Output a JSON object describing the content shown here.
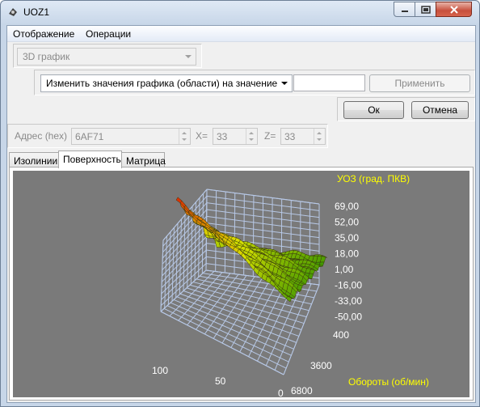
{
  "window": {
    "title": "UOZ1"
  },
  "menu": {
    "items": [
      "Отображение",
      "Операции"
    ]
  },
  "view_select": {
    "value": "3D график"
  },
  "operation": {
    "select_value": "Изменить значения графика (области) на значение",
    "value_input": "",
    "apply_label": "Применить"
  },
  "dialog": {
    "ok_label": "Ок",
    "cancel_label": "Отмена"
  },
  "address": {
    "label": "Адрес (hex)",
    "value": "6AF71",
    "x_label": "X=",
    "x_value": "33",
    "z_label": "Z=",
    "z_value": "33"
  },
  "tabs": [
    "Изолинии",
    "Поверхность",
    "Матрица"
  ],
  "active_tab": 1,
  "colors": {
    "plot_bg": "#7a7a7a",
    "axis_text": "#ffff00",
    "tick_text": "#ffffff",
    "grid": "#b7c8e6",
    "surface_low": "#2f8f00",
    "surface_mid": "#d8e000",
    "surface_high": "#e02000"
  },
  "chart_data": {
    "type": "surface",
    "title": "УОЗ (град. ПКВ)",
    "xlabel": "Обороты (об/мин)",
    "z_ticks": [
      "69,00",
      "52,00",
      "35,00",
      "18,00",
      "1,00",
      "-16,00",
      "-33,00",
      "-50,00"
    ],
    "rpm_ticks": [
      "400",
      "3600",
      "6800"
    ],
    "load_ticks": [
      "100",
      "50",
      "0"
    ],
    "zlim": [
      -50,
      69
    ],
    "surface_corner_values": {
      "high_load_low_rpm": 62,
      "low_load_low_rpm": 8,
      "high_load_high_rpm": 25,
      "low_load_high_rpm": 5
    }
  }
}
